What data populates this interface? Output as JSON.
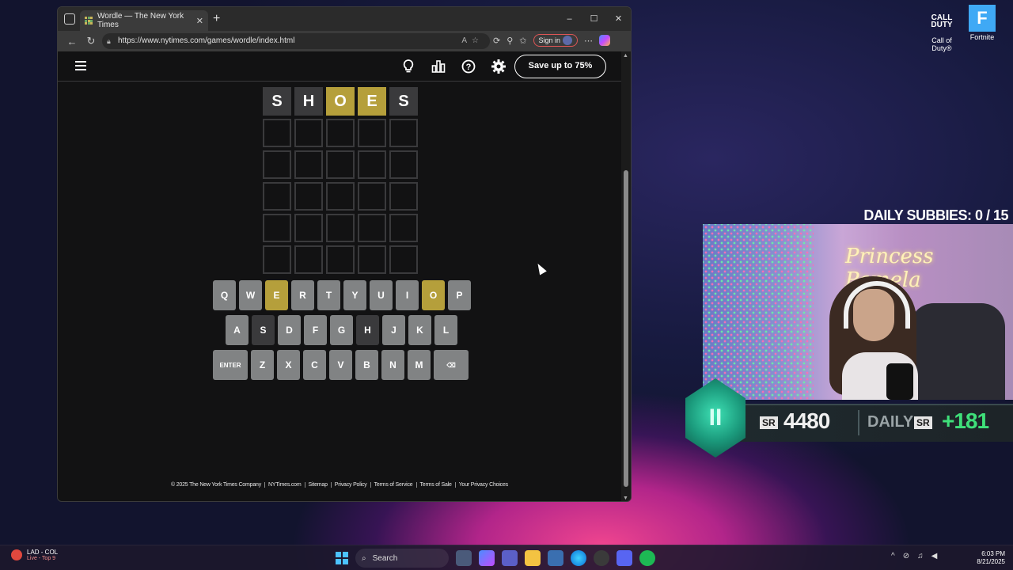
{
  "desktop": {
    "icons": [
      {
        "logo_text": "CALL\nDUTY",
        "label": "Call of\nDuty®"
      },
      {
        "logo_text": "F",
        "label": "Fortnite"
      }
    ]
  },
  "browser": {
    "tab_title": "Wordle — The New York Times",
    "url": "https://www.nytimes.com/games/wordle/index.html",
    "sign_in_label": "Sign in",
    "window_buttons": [
      "–",
      "☐",
      "✕"
    ]
  },
  "wordle": {
    "save_button": "Save up to 75%",
    "board": [
      [
        {
          "l": "S",
          "s": "absent"
        },
        {
          "l": "H",
          "s": "absent"
        },
        {
          "l": "O",
          "s": "present"
        },
        {
          "l": "E",
          "s": "present"
        },
        {
          "l": "S",
          "s": "absent"
        }
      ],
      [
        {
          "l": "",
          "s": "empty"
        },
        {
          "l": "",
          "s": "empty"
        },
        {
          "l": "",
          "s": "empty"
        },
        {
          "l": "",
          "s": "empty"
        },
        {
          "l": "",
          "s": "empty"
        }
      ],
      [
        {
          "l": "",
          "s": "empty"
        },
        {
          "l": "",
          "s": "empty"
        },
        {
          "l": "",
          "s": "empty"
        },
        {
          "l": "",
          "s": "empty"
        },
        {
          "l": "",
          "s": "empty"
        }
      ],
      [
        {
          "l": "",
          "s": "empty"
        },
        {
          "l": "",
          "s": "empty"
        },
        {
          "l": "",
          "s": "empty"
        },
        {
          "l": "",
          "s": "empty"
        },
        {
          "l": "",
          "s": "empty"
        }
      ],
      [
        {
          "l": "",
          "s": "empty"
        },
        {
          "l": "",
          "s": "empty"
        },
        {
          "l": "",
          "s": "empty"
        },
        {
          "l": "",
          "s": "empty"
        },
        {
          "l": "",
          "s": "empty"
        }
      ],
      [
        {
          "l": "",
          "s": "empty"
        },
        {
          "l": "",
          "s": "empty"
        },
        {
          "l": "",
          "s": "empty"
        },
        {
          "l": "",
          "s": "empty"
        },
        {
          "l": "",
          "s": "empty"
        }
      ]
    ],
    "keyboard": [
      [
        {
          "k": "Q"
        },
        {
          "k": "W"
        },
        {
          "k": "E",
          "s": "present"
        },
        {
          "k": "R"
        },
        {
          "k": "T"
        },
        {
          "k": "Y"
        },
        {
          "k": "U"
        },
        {
          "k": "I"
        },
        {
          "k": "O",
          "s": "present"
        },
        {
          "k": "P"
        }
      ],
      [
        {
          "k": "A"
        },
        {
          "k": "S",
          "s": "absent"
        },
        {
          "k": "D"
        },
        {
          "k": "F"
        },
        {
          "k": "G"
        },
        {
          "k": "H",
          "s": "absent"
        },
        {
          "k": "J"
        },
        {
          "k": "K"
        },
        {
          "k": "L"
        }
      ],
      [
        {
          "k": "ENTER",
          "wide": true
        },
        {
          "k": "Z"
        },
        {
          "k": "X"
        },
        {
          "k": "C"
        },
        {
          "k": "V"
        },
        {
          "k": "B"
        },
        {
          "k": "N"
        },
        {
          "k": "M"
        },
        {
          "k": "⌫",
          "wide": true
        }
      ]
    ],
    "footer": [
      "© 2025 The New York Times Company",
      "NYTimes.com",
      "Sitemap",
      "Privacy Policy",
      "Terms of Service",
      "Terms of Sale",
      "Your Privacy Choices"
    ],
    "colors": {
      "present": "#b59f3b",
      "absent": "#3a3a3c",
      "key": "#818384",
      "background": "#121213"
    }
  },
  "stream": {
    "daily_subbies": "DAILY SUBBIES:  0 / 15",
    "neon_sign": "Princess Pamela",
    "badge": "II",
    "sr_label": "SR",
    "sr_value": "4480",
    "daily_label": "DAILY",
    "daily_gain": "+181",
    "colors": {
      "gain": "#3fe07a",
      "badge": "#1b9a7c"
    }
  },
  "taskbar": {
    "weather_title": "LAD - COL",
    "weather_sub": "Live - Top 9",
    "search_placeholder": "Search",
    "time": "6:03 PM",
    "date": "8/21/2025"
  }
}
